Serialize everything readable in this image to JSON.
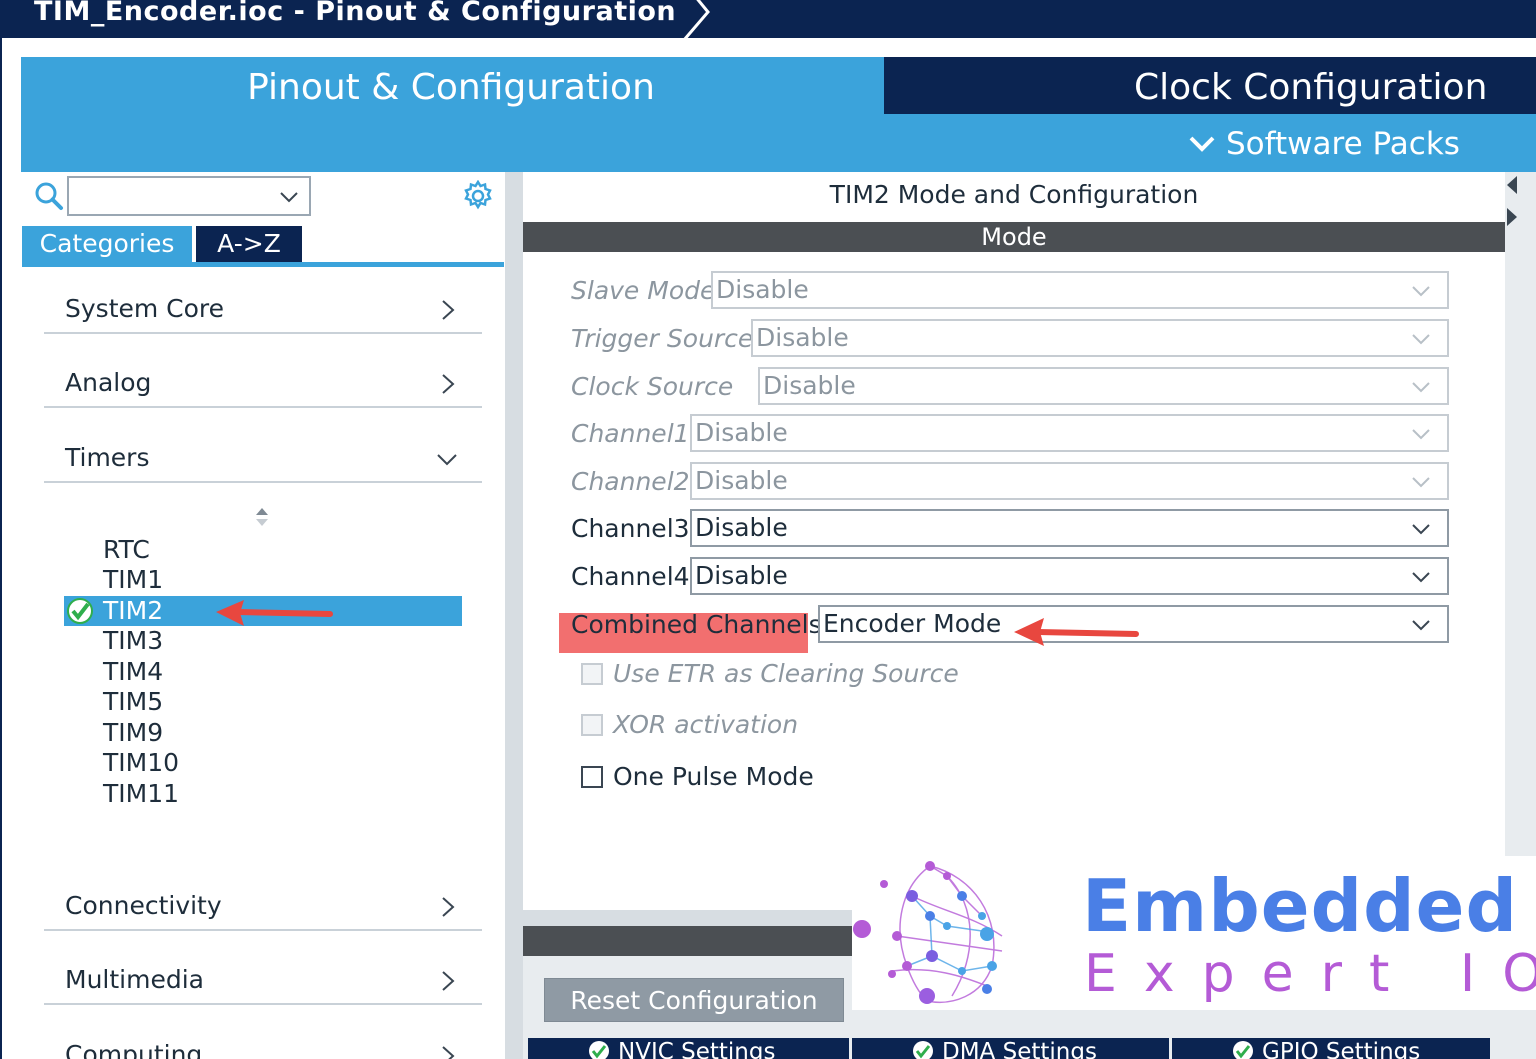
{
  "window": {
    "title": "TIM_Encoder.ioc - Pinout & Configuration"
  },
  "header": {
    "tab_pinout": "Pinout & Configuration",
    "tab_clock": "Clock Configuration",
    "software_packs": "Software Packs"
  },
  "sidebar": {
    "search_value": "",
    "tabs": [
      "Categories",
      "A->Z"
    ],
    "categories": [
      {
        "label": "System Core",
        "state": "collapsed"
      },
      {
        "label": "Analog",
        "state": "collapsed"
      },
      {
        "label": "Timers",
        "state": "expanded"
      },
      {
        "label": "Connectivity",
        "state": "collapsed"
      },
      {
        "label": "Multimedia",
        "state": "collapsed"
      },
      {
        "label": "Computing",
        "state": "collapsed"
      }
    ],
    "timers": [
      "RTC",
      "TIM1",
      "TIM2",
      "TIM3",
      "TIM4",
      "TIM5",
      "TIM9",
      "TIM10",
      "TIM11"
    ],
    "selected_timer": "TIM2"
  },
  "panel": {
    "title": "TIM2 Mode and Configuration",
    "mode_header": "Mode",
    "rows": [
      {
        "label": "Slave Mode",
        "value": "Disable",
        "enabled": false
      },
      {
        "label": "Trigger Source",
        "value": "Disable",
        "enabled": false
      },
      {
        "label": "Clock Source",
        "value": "Disable",
        "enabled": false
      },
      {
        "label": "Channel1",
        "value": "Disable",
        "enabled": false
      },
      {
        "label": "Channel2",
        "value": "Disable",
        "enabled": false
      },
      {
        "label": "Channel3",
        "value": "Disable",
        "enabled": true
      },
      {
        "label": "Channel4",
        "value": "Disable",
        "enabled": true
      },
      {
        "label": "Combined Channels",
        "value": "Encoder Mode",
        "enabled": true
      }
    ],
    "checkboxes": [
      {
        "label": "Use ETR as Clearing Source",
        "checked": false,
        "enabled": false
      },
      {
        "label": "XOR activation",
        "checked": false,
        "enabled": false
      },
      {
        "label": "One Pulse Mode",
        "checked": false,
        "enabled": true
      }
    ],
    "reset_button": "Reset Configuration",
    "bottom_tabs": [
      "NVIC Settings",
      "DMA Settings",
      "GPIO Settings"
    ]
  },
  "watermark": {
    "line1": "Embedded",
    "line2": "Expert IO"
  },
  "colors": {
    "navy": "#0b2451",
    "accent_blue": "#3ba3db",
    "annotation_red": "#e8473f",
    "highlight": "#f26f6f"
  }
}
